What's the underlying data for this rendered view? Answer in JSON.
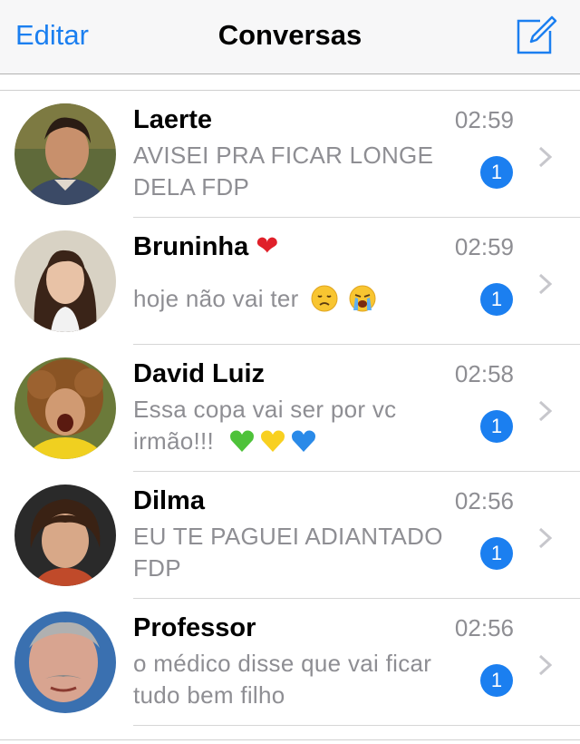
{
  "navbar": {
    "edit_label": "Editar",
    "title": "Conversas",
    "compose_icon": "compose-icon"
  },
  "conversations": [
    {
      "name": "Laerte",
      "time": "02:59",
      "preview_line1": "AVISEI PRA FICAR LONGE",
      "preview_line2": "DELA FDP",
      "unread": "1"
    },
    {
      "name": "Bruninha",
      "name_emoji": "❤",
      "time": "02:59",
      "preview_line1": "hoje não vai ter",
      "unread": "1"
    },
    {
      "name": "David Luiz",
      "time": "02:58",
      "preview_line1": "Essa copa vai ser por vc",
      "preview_line2": "irmão!!!",
      "unread": "1"
    },
    {
      "name": "Dilma",
      "time": "02:56",
      "preview_line1": "EU TE PAGUEI ADIANTADO",
      "preview_line2": "FDP",
      "unread": "1"
    },
    {
      "name": "Professor",
      "time": "02:56",
      "preview_line1": "o médico disse que vai ficar",
      "preview_line2": "tudo bem filho",
      "unread": "1"
    }
  ],
  "colors": {
    "accent": "#1b7ff0",
    "secondary_text": "#8e8e93"
  }
}
